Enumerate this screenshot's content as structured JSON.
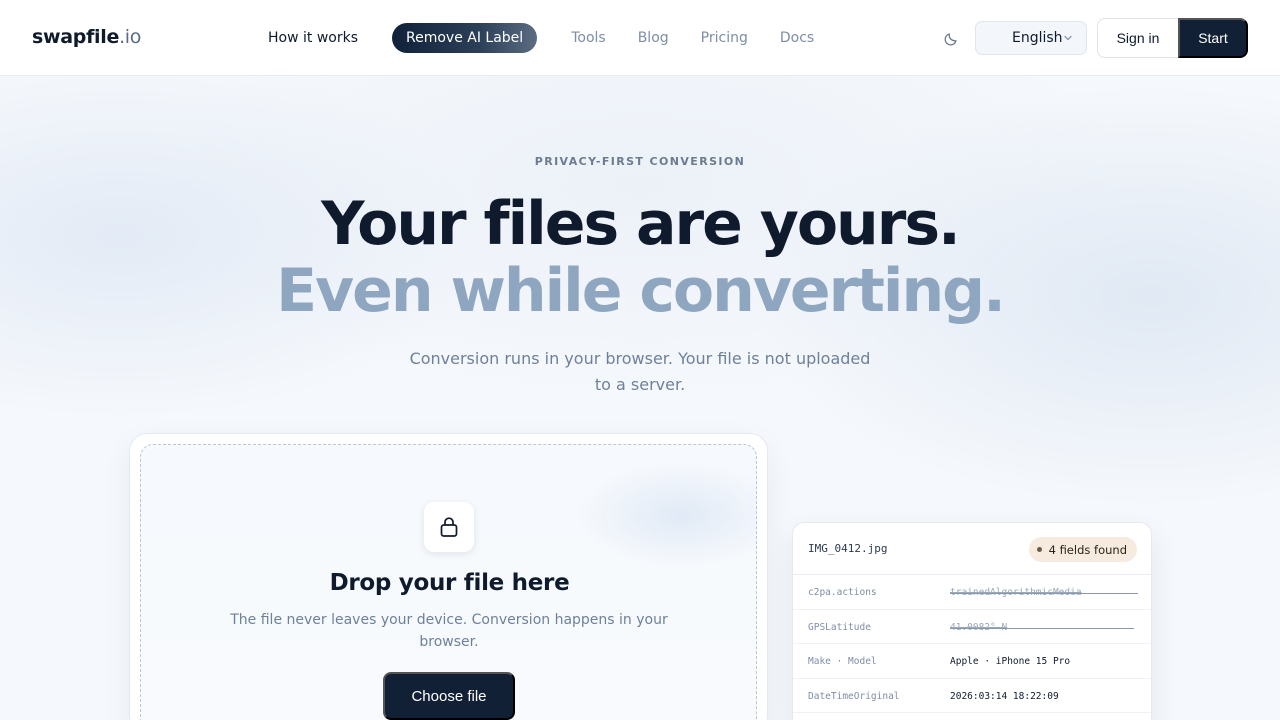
{
  "header": {
    "logo_main": "swapfile",
    "logo_tld": ".io",
    "nav": [
      {
        "label": "How it works"
      },
      {
        "label": "Remove AI Label"
      },
      {
        "label": "Tools"
      },
      {
        "label": "Blog"
      },
      {
        "label": "Pricing"
      },
      {
        "label": "Docs"
      }
    ],
    "language": "English",
    "signin_label": "Sign in",
    "start_label": "Start"
  },
  "hero": {
    "eyebrow": "PRIVACY-FIRST CONVERSION",
    "title_line1": "Your files are yours.",
    "title_line2": "Even while converting.",
    "subtitle": "Conversion runs in your browser. Your file is not uploaded to a server."
  },
  "dropzone": {
    "title": "Drop your file here",
    "text": "The file never leaves your device. Conversion happens in your browser.",
    "button_label": "Choose file"
  },
  "metadata": {
    "file_name": "IMG_0412.jpg",
    "badge": "4 fields found",
    "rows": [
      {
        "key": "c2pa.actions",
        "value": "trainedAlgorithmicMedia",
        "removed": true
      },
      {
        "key": "GPSLatitude",
        "value": "41.0082° N",
        "removed": true
      },
      {
        "key": "Make · Model",
        "value": "Apple · iPhone 15 Pro",
        "removed": false
      },
      {
        "key": "DateTimeOriginal",
        "value": "2026:03:14 18:22:09",
        "removed": false
      }
    ]
  },
  "colors": {
    "primary": "#112035",
    "muted_title": "#8fa6c0",
    "badge_bg": "#f6ebde"
  }
}
